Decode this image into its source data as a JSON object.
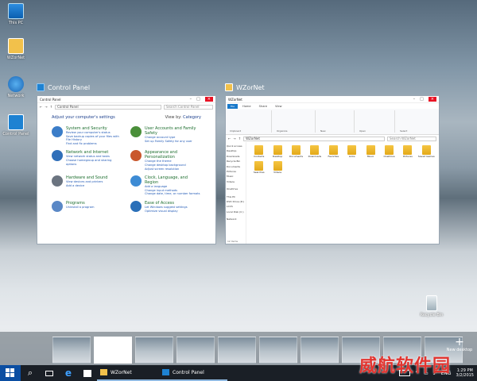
{
  "desktop": {
    "icons": [
      {
        "label": "This PC"
      },
      {
        "label": "WZorNet"
      },
      {
        "label": "Network"
      },
      {
        "label": "Control Panel"
      }
    ],
    "recycle_bin": "Recycle Bin"
  },
  "windows": {
    "control_panel": {
      "caption": "Control Panel",
      "title": "Control Panel",
      "address": "Control Panel",
      "search_placeholder": "Search Control Panel",
      "heading": "Adjust your computer's settings",
      "view_by_label": "View by:",
      "view_by_value": "Category",
      "categories": [
        {
          "title": "System and Security",
          "links": [
            "Review your computer's status",
            "Save backup copies of your files with File History",
            "Find and fix problems"
          ],
          "color": "#3b7dc8"
        },
        {
          "title": "User Accounts and Family Safety",
          "links": [
            "Change account type",
            "Set up Family Safety for any user"
          ],
          "color": "#4a8f3a"
        },
        {
          "title": "Network and Internet",
          "links": [
            "View network status and tasks",
            "Choose homegroup and sharing options"
          ],
          "color": "#2f6fb9"
        },
        {
          "title": "Appearance and Personalization",
          "links": [
            "Change the theme",
            "Change desktop background",
            "Adjust screen resolution"
          ],
          "color": "#c9572c"
        },
        {
          "title": "Hardware and Sound",
          "links": [
            "View devices and printers",
            "Add a device"
          ],
          "color": "#6b7480"
        },
        {
          "title": "Clock, Language, and Region",
          "links": [
            "Add a language",
            "Change input methods",
            "Change date, time, or number formats"
          ],
          "color": "#3d8bd4"
        },
        {
          "title": "Programs",
          "links": [
            "Uninstall a program"
          ],
          "color": "#5a88c6"
        },
        {
          "title": "Ease of Access",
          "links": [
            "Let Windows suggest settings",
            "Optimize visual display"
          ],
          "color": "#2a6fb8"
        }
      ]
    },
    "explorer": {
      "caption": "WZorNet",
      "title": "WZorNet",
      "tabs": [
        "File",
        "Home",
        "Share",
        "View"
      ],
      "ribbon_groups": [
        "Clipboard",
        "Organize",
        "New",
        "Open",
        "Select"
      ],
      "address": "WZorNet",
      "search_placeholder": "Search WZorNet",
      "nav": [
        "Quick access",
        "Desktop",
        "Downloads",
        "Recycle Bin",
        "Documents",
        "Pictures",
        "Music",
        "Videos",
        "OneDrive",
        "This PC",
        "DVD Drive (D:) LCCS",
        "Local Disk (C:)",
        "Network"
      ],
      "files": [
        "Contacts",
        "Desktop",
        "Documents",
        "Downloads",
        "Favorites",
        "Links",
        "Music",
        "OneDrive",
        "Pictures",
        "Saved Games",
        "Searches",
        "Videos"
      ],
      "status": "12 items"
    }
  },
  "task_view": {
    "new_desktop": "New desktop",
    "thumb_count": 10
  },
  "taskbar": {
    "apps": [
      {
        "label": "WZorNet"
      },
      {
        "label": "Control Panel"
      }
    ],
    "tray": {
      "lang": "ENG",
      "time": "1:29 PM",
      "date": "3/2/2015"
    }
  },
  "watermark": "威航软件园"
}
